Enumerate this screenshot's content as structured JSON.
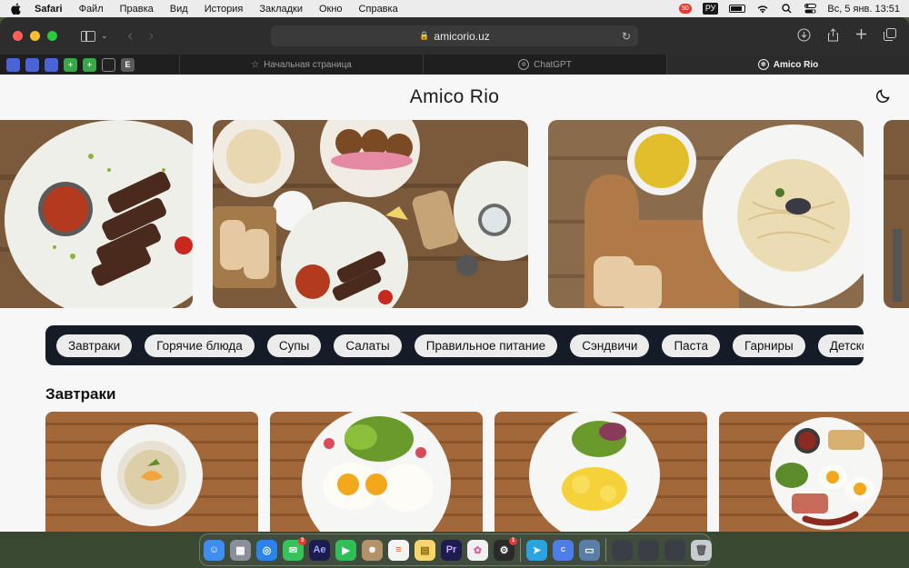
{
  "menubar": {
    "app_name": "Safari",
    "menus": [
      "Файл",
      "Правка",
      "Вид",
      "История",
      "Закладки",
      "Окно",
      "Справка"
    ],
    "notification_badge": "50",
    "input_language": "РУ",
    "date_time": "Вс, 5 янв.  13:51"
  },
  "browser": {
    "url": "amicorio.uz",
    "tabs": [
      {
        "label": "Начальная страница",
        "icon": "star-icon",
        "active": false
      },
      {
        "label": "ChatGPT",
        "icon": "chatgpt-icon",
        "active": false
      },
      {
        "label": "Amico Rio",
        "icon": "amico-icon",
        "active": true
      }
    ],
    "favorites": [
      "bookmark-1",
      "bookmark-2",
      "bookmark-3",
      "bookmark-4",
      "bookmark-5",
      "bookmark-6",
      "bookmark-7"
    ],
    "favorite_letters": [
      "",
      "",
      "",
      "+",
      "+",
      "",
      "E"
    ]
  },
  "site": {
    "title": "Amico Rio",
    "categories": [
      "Завтраки",
      "Горячие блюда",
      "Супы",
      "Салаты",
      "Правильное питание",
      "Сэндвичи",
      "Паста",
      "Гарниры",
      "Детское меню"
    ],
    "section_title": "Завтраки"
  },
  "dock": {
    "apps": [
      {
        "name": "finder",
        "color": "#3d8ef0",
        "glyph": "☺"
      },
      {
        "name": "launchpad",
        "color": "#8a8f9a",
        "glyph": "▦"
      },
      {
        "name": "safari",
        "color": "#2b84e8",
        "glyph": "◎"
      },
      {
        "name": "messages",
        "color": "#38c25a",
        "glyph": "✉",
        "badge": "3"
      },
      {
        "name": "after-effects",
        "color": "#1d1c4e",
        "glyph": "Ae"
      },
      {
        "name": "facetime",
        "color": "#2ec057",
        "glyph": "▶"
      },
      {
        "name": "contacts",
        "color": "#b5936a",
        "glyph": "☻"
      },
      {
        "name": "reminders",
        "color": "#f4f4f4",
        "glyph": "≡"
      },
      {
        "name": "notes",
        "color": "#f6d66a",
        "glyph": "▤"
      },
      {
        "name": "premiere",
        "color": "#1d1c4e",
        "glyph": "Pr"
      },
      {
        "name": "photos",
        "color": "#f0f0f0",
        "glyph": "✿"
      },
      {
        "name": "chatgpt",
        "color": "#2a2a2a",
        "glyph": "⚙",
        "badge": "1"
      },
      {
        "name": "telegram",
        "color": "#2aa3e0",
        "glyph": "➤"
      },
      {
        "name": "canva",
        "color": "#4c7de8",
        "glyph": "C"
      },
      {
        "name": "preview",
        "color": "#5b7ea8",
        "glyph": "▭"
      },
      {
        "name": "window-1",
        "color": "#3a3e45",
        "glyph": ""
      },
      {
        "name": "window-2",
        "color": "#3a3e45",
        "glyph": ""
      },
      {
        "name": "window-3",
        "color": "#3a3e45",
        "glyph": ""
      },
      {
        "name": "trash",
        "color": "#c8ccd0",
        "glyph": "🗑"
      }
    ]
  },
  "colors": {
    "category_bar": "#151c27",
    "pill": "#ececec",
    "page_bg": "#f7f7f7"
  }
}
